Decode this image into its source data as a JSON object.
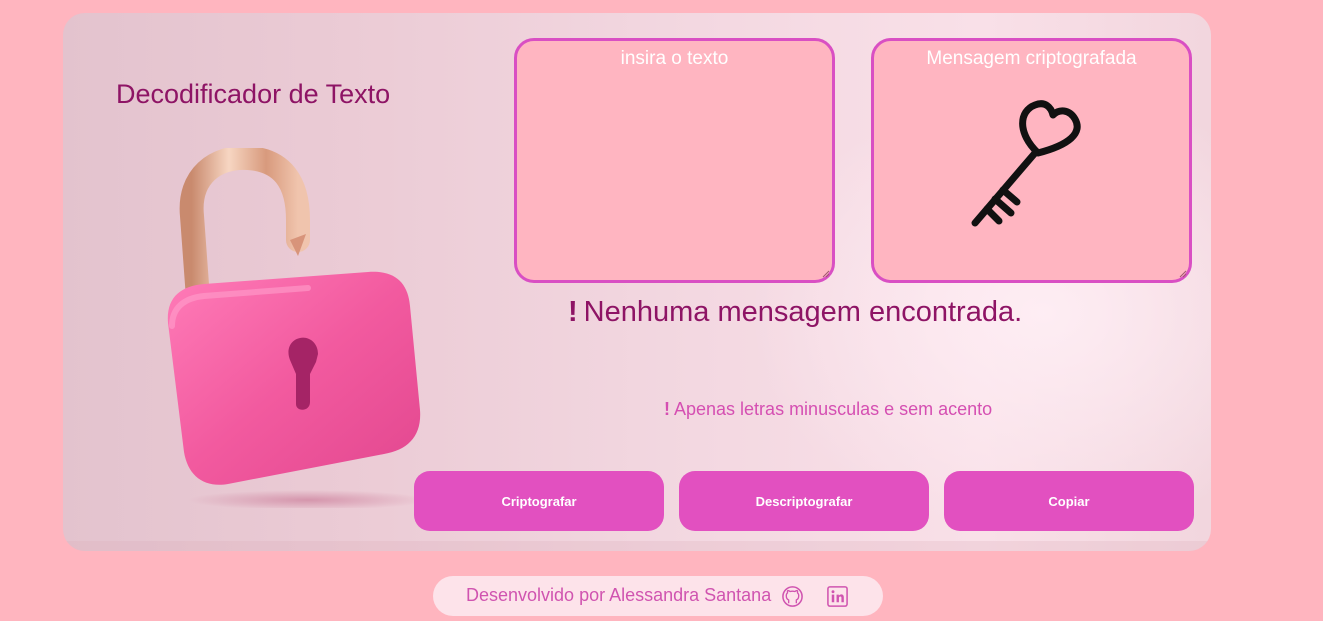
{
  "app": {
    "title": "Decodificador de Texto"
  },
  "input_box": {
    "placeholder": "insira o texto"
  },
  "output_box": {
    "title": "Mensagem criptografada",
    "icon": "key-icon"
  },
  "messages": {
    "not_found_bang": "!",
    "not_found": "Nenhuma mensagem encontrada.",
    "hint_bang": "!",
    "hint": "Apenas letras minusculas e sem acento"
  },
  "buttons": {
    "encrypt": "Criptografar",
    "decrypt": "Descriptografar",
    "copy": "Copiar"
  },
  "footer": {
    "credit": "Desenvolvido por Alessandra Santana",
    "icons": [
      "github-icon",
      "linkedin-icon"
    ]
  },
  "colors": {
    "page_background": "#ffb5bf",
    "accent": "#e250c0",
    "title_text": "#8e1465",
    "box_border": "#d94fc3",
    "box_fill": "#ffb5c1"
  }
}
